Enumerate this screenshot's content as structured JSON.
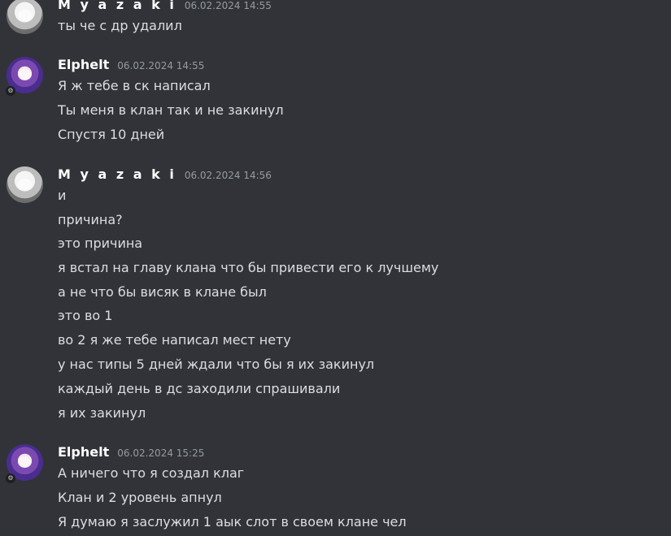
{
  "messages": [
    {
      "user": "M y a z a k i",
      "time": "06.02.2024 14:55",
      "lines": [
        "ты че с др удалил"
      ]
    },
    {
      "user": "Elphelt",
      "time": "06.02.2024 14:55",
      "lines": [
        "Я ж тебе в ск написал",
        "Ты меня в клан так и не закинул",
        "Спустя 10 дней"
      ]
    },
    {
      "user": "M y a z a k i",
      "time": "06.02.2024 14:56",
      "lines": [
        "и",
        "причина?",
        "это причина",
        "я встал на главу клана что бы привести его к лучшему",
        "а не что бы висяк в клане был",
        "это во 1",
        "во 2 я же тебе написал мест нету",
        "у нас типы 5 дней ждали что бы я их закинул",
        "каждый день в дс заходили спрашивали",
        "я их закинул"
      ]
    },
    {
      "user": "Elphelt",
      "time": "06.02.2024 15:25",
      "lines": [
        "А ничего что я создал клаг",
        "Клан и 2 уровень апнул",
        "Я думаю я заслужил 1 аык слот в своем клане чел"
      ]
    }
  ],
  "avatar_badge_icon": "moderator-badge-icon"
}
